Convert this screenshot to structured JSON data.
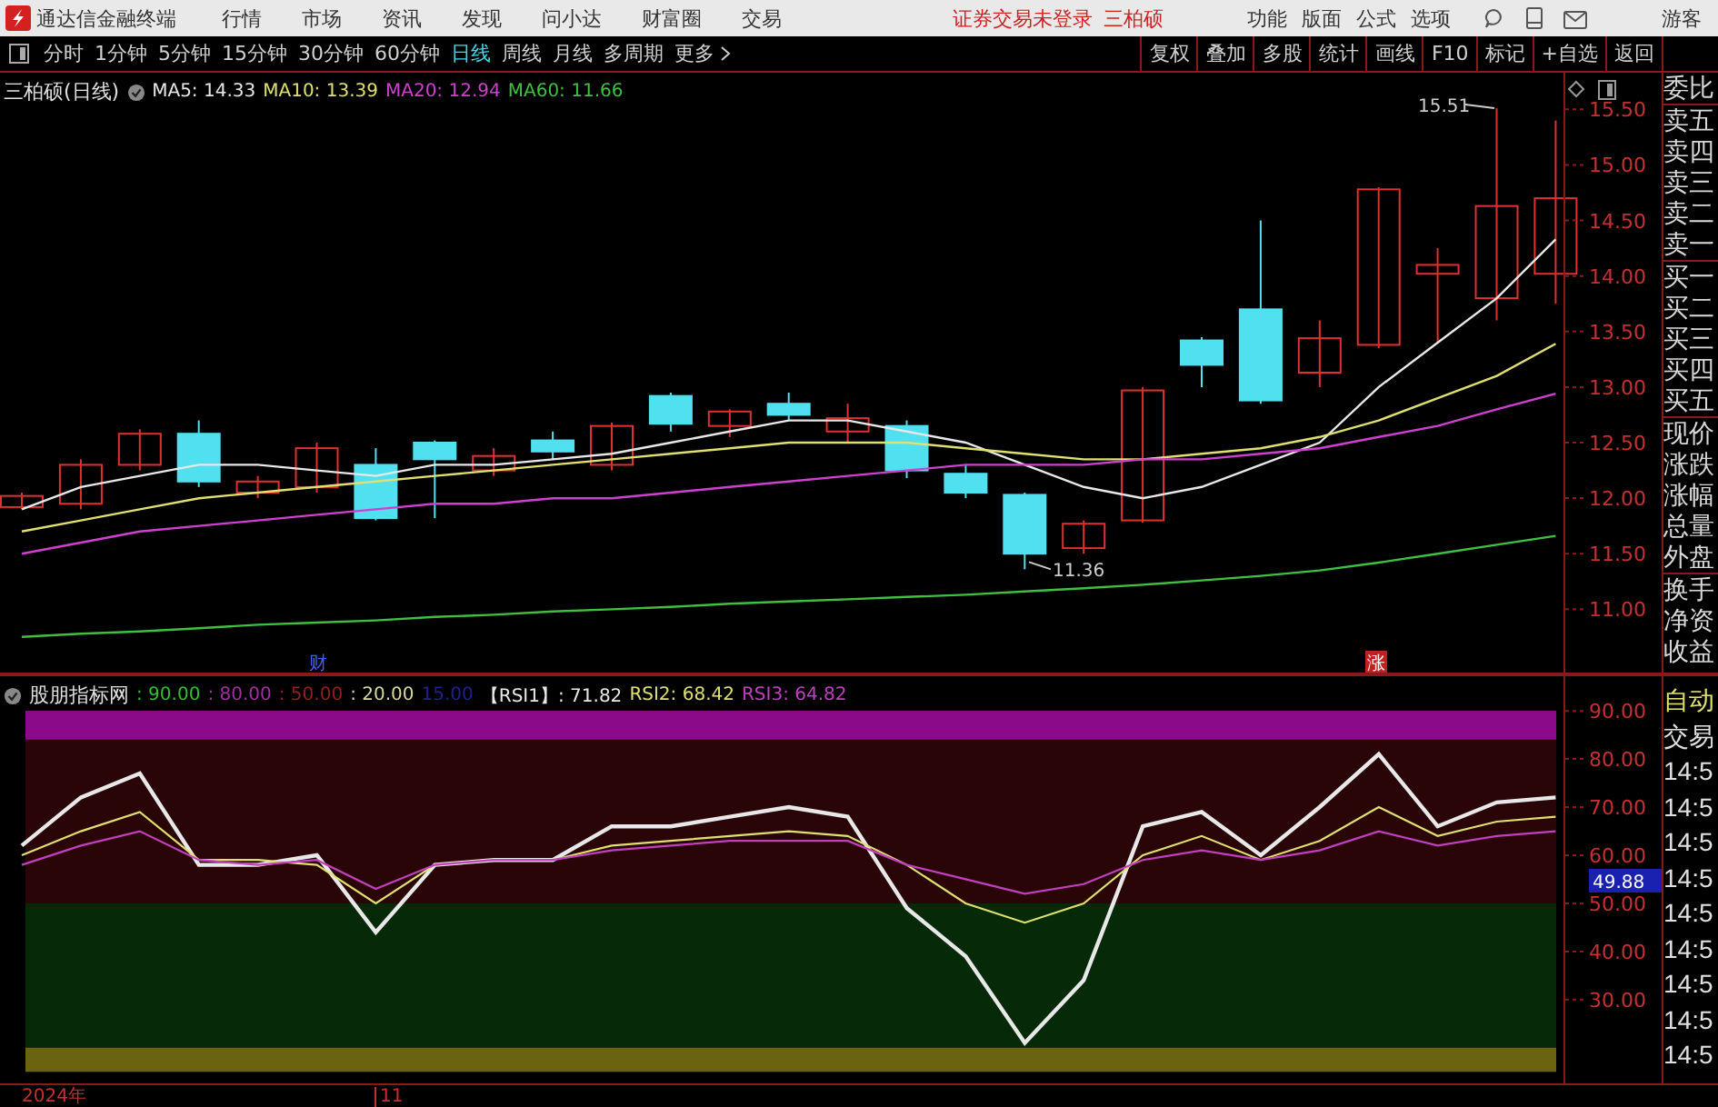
{
  "title_bar": {
    "app_name": "通达信金融终端",
    "menu": [
      "行情",
      "市场",
      "资讯",
      "发现",
      "问小达",
      "财富圈",
      "交易"
    ],
    "notice": "证券交易未登录",
    "stock": "三柏硕",
    "right_menu": [
      "功能",
      "版面",
      "公式",
      "选项"
    ],
    "user": "游客"
  },
  "toolbar": {
    "periods": [
      {
        "label": "分时",
        "selected": false
      },
      {
        "label": "1分钟",
        "selected": false
      },
      {
        "label": "5分钟",
        "selected": false
      },
      {
        "label": "15分钟",
        "selected": false
      },
      {
        "label": "30分钟",
        "selected": false
      },
      {
        "label": "60分钟",
        "selected": false
      },
      {
        "label": "日线",
        "selected": true
      },
      {
        "label": "周线",
        "selected": false
      },
      {
        "label": "月线",
        "selected": false
      },
      {
        "label": "多周期",
        "selected": false
      }
    ],
    "more": "更多",
    "buttons": [
      "复权",
      "叠加",
      "多股",
      "统计",
      "画线",
      "F10",
      "标记",
      "+自选",
      "返回"
    ]
  },
  "price_panel": {
    "title": "三柏硕(日线)",
    "legend": [
      {
        "label": "MA5: 14.33",
        "color": "#e8e8e8"
      },
      {
        "label": "MA10: 13.39",
        "color": "#e0e070"
      },
      {
        "label": "MA20: 12.94",
        "color": "#d040d0"
      },
      {
        "label": "MA60: 11.66",
        "color": "#40c040"
      }
    ],
    "high_mark": "15.51",
    "low_mark": "11.36",
    "events": [
      {
        "label": "财",
        "kind": "finance"
      },
      {
        "label": "涨",
        "kind": "limit_up"
      }
    ],
    "chart_data": {
      "type": "line",
      "ylim": [
        10.43,
        15.83
      ],
      "yticks": [
        {
          "value": 11,
          "label": "11.00"
        },
        {
          "value": 11.5,
          "label": "11.50"
        },
        {
          "value": 12,
          "label": "12.00"
        },
        {
          "value": 12.5,
          "label": "12.50"
        },
        {
          "value": 13,
          "label": "13.00"
        },
        {
          "value": 13.5,
          "label": "13.50"
        },
        {
          "value": 14,
          "label": "14.00"
        },
        {
          "value": 14.5,
          "label": "14.50"
        },
        {
          "value": 15,
          "label": "15.00"
        },
        {
          "value": 15.5,
          "label": "15.50"
        }
      ],
      "series": [
        {
          "color": "#e8e8e8",
          "values": [
            11.9,
            12.1,
            12.2,
            12.3,
            12.3,
            12.25,
            12.2,
            12.3,
            12.3,
            12.35,
            12.4,
            12.5,
            12.6,
            12.7,
            12.7,
            12.6,
            12.5,
            12.3,
            12.1,
            12.0,
            12.1,
            12.3,
            12.5,
            13.0,
            13.4,
            13.8,
            14.33
          ]
        },
        {
          "color": "#e0e070",
          "values": [
            11.7,
            11.8,
            11.9,
            12.0,
            12.05,
            12.1,
            12.15,
            12.2,
            12.25,
            12.3,
            12.35,
            12.4,
            12.45,
            12.5,
            12.5,
            12.5,
            12.45,
            12.4,
            12.35,
            12.35,
            12.4,
            12.45,
            12.55,
            12.7,
            12.9,
            13.1,
            13.39
          ]
        },
        {
          "color": "#d040d0",
          "values": [
            11.5,
            11.6,
            11.7,
            11.75,
            11.8,
            11.85,
            11.9,
            11.95,
            11.95,
            12.0,
            12.0,
            12.05,
            12.1,
            12.15,
            12.2,
            12.25,
            12.3,
            12.3,
            12.3,
            12.35,
            12.35,
            12.4,
            12.45,
            12.55,
            12.65,
            12.8,
            12.94
          ]
        },
        {
          "color": "#40c040",
          "values": [
            10.75,
            10.78,
            10.8,
            10.83,
            10.86,
            10.88,
            10.9,
            10.93,
            10.95,
            10.98,
            11.0,
            11.02,
            11.05,
            11.07,
            11.09,
            11.11,
            11.13,
            11.16,
            11.19,
            11.22,
            11.26,
            11.3,
            11.35,
            11.42,
            11.5,
            11.58,
            11.66
          ]
        }
      ]
    }
  },
  "quote_side": {
    "groups": [
      [
        "委比"
      ],
      [
        "卖五",
        "卖四",
        "卖三",
        "卖二",
        "卖一"
      ],
      [
        "买一",
        "买二",
        "买三",
        "买四",
        "买五"
      ],
      [
        "现价",
        "涨跌",
        "涨幅",
        "总量",
        "外盘"
      ],
      [
        "换手",
        "净资",
        "收益"
      ]
    ]
  },
  "rsi_panel": {
    "name": "股朋指标网",
    "legend": [
      {
        "label": ": 90.00",
        "color": "#30c030"
      },
      {
        "label": ": 80.00",
        "color": "#a030a0"
      },
      {
        "label": ": 50.00",
        "color": "#902020"
      },
      {
        "label": ": 20.00",
        "color": "#d8d8a0"
      },
      {
        "label": "15.00",
        "color": "#202090"
      },
      {
        "label": "【RSI1】: 71.82",
        "color": "#e8e8e8"
      },
      {
        "label": "RSI2: 68.42",
        "color": "#e0e070"
      },
      {
        "label": "RSI3: 64.82",
        "color": "#c040c0"
      }
    ],
    "current": "49.88",
    "chart_data": {
      "type": "line",
      "ylim": [
        12.6,
        97.2
      ],
      "yticks": [
        {
          "value": 30,
          "label": "30.00"
        },
        {
          "value": 40,
          "label": "40.00"
        },
        {
          "value": 50,
          "label": "50.00"
        },
        {
          "value": 60,
          "label": "60.00"
        },
        {
          "value": 70,
          "label": "70.00"
        },
        {
          "value": 80,
          "label": "80.00"
        },
        {
          "value": 90,
          "label": "90.00"
        }
      ],
      "series": [
        {
          "color": "#e8e8e8",
          "values": [
            62,
            72,
            77,
            58,
            58,
            60,
            44,
            58,
            59,
            59,
            66,
            66,
            68,
            70,
            68,
            49,
            39,
            21,
            34,
            66,
            69,
            60,
            70,
            81,
            66,
            71,
            72
          ]
        },
        {
          "color": "#e0e070",
          "values": [
            60,
            65,
            69,
            59,
            59,
            58,
            50,
            58,
            59,
            59,
            62,
            63,
            64,
            65,
            64,
            58,
            50,
            46,
            50,
            60,
            64,
            59,
            63,
            70,
            64,
            67,
            68
          ]
        },
        {
          "color": "#c040c0",
          "values": [
            58,
            62,
            65,
            59,
            58,
            59,
            53,
            58,
            59,
            59,
            61,
            62,
            63,
            63,
            63,
            58,
            55,
            52,
            54,
            59,
            61,
            59,
            61,
            65,
            62,
            64,
            65
          ]
        }
      ]
    }
  },
  "rsi_side": [
    {
      "label": "自动",
      "kind": "mode"
    },
    {
      "label": "交易",
      "kind": "header"
    },
    {
      "label": "14:5",
      "kind": "time"
    },
    {
      "label": "14:5",
      "kind": "time"
    },
    {
      "label": "14:5",
      "kind": "time"
    },
    {
      "label": "14:5",
      "kind": "time"
    },
    {
      "label": "14:5",
      "kind": "time"
    },
    {
      "label": "14:5",
      "kind": "time"
    },
    {
      "label": "14:5",
      "kind": "time"
    },
    {
      "label": "14:5",
      "kind": "time"
    },
    {
      "label": "14:5",
      "kind": "time"
    }
  ],
  "time_axis": [
    "2024年",
    "11"
  ]
}
